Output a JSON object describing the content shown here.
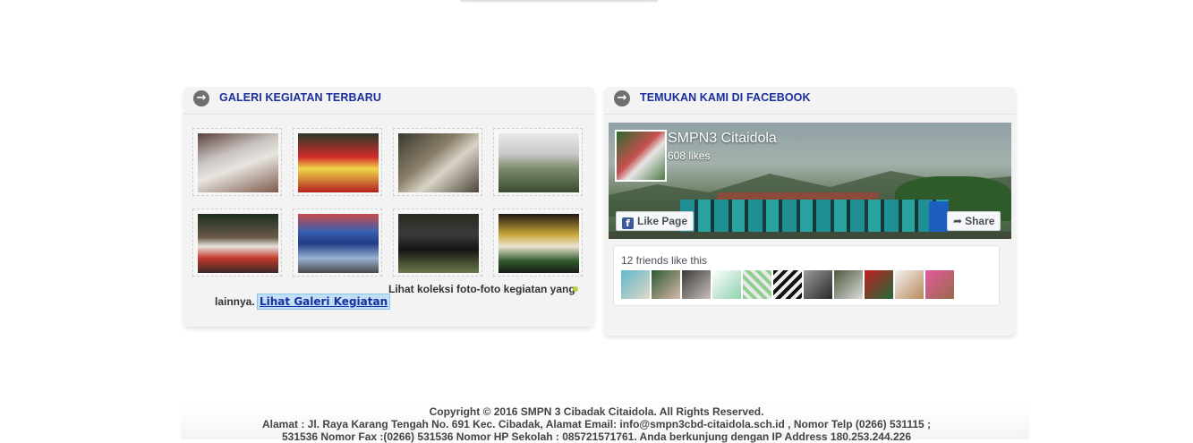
{
  "gallery": {
    "title": "GALERI KEGIATAN TERBARU",
    "photos": [
      "Foto kegiatan 1",
      "Foto kegiatan 2",
      "Foto kegiatan 3",
      "Foto kegiatan 4",
      "Foto kegiatan 5",
      "Foto kegiatan 6",
      "Foto kegiatan 7",
      "Foto kegiatan 8"
    ],
    "text_line1": "Lihat koleksi foto-foto kegiatan yang",
    "text_line2": "lainnya.",
    "link_label": "Lihat Galeri Kegiatan"
  },
  "facebook": {
    "title": "TEMUKAN KAMI DI FACEBOOK",
    "page_name": "SMPN3 Citaidola",
    "likes": "608 likes",
    "like_button": "Like Page",
    "share_button": "Share",
    "friends_text": "12 friends like this",
    "friend_count": 12
  },
  "footer": {
    "copyright": "Copyright © 2016 SMPN 3 Cibadak Citaidola. All Rights Reserved.",
    "address_line1": "Alamat : Jl. Raya Karang Tengah No. 691 Kec. Cibadak, Alamat Email: info@smpn3cbd-citaidola.sch.id , Nomor Telp (0266) 531115 ;",
    "address_line2": "531536 Nomor Fax :(0266) 531536 Nomor HP Sekolah : 085721571761. Anda berkunjung dengan IP Address 180.253.244.226"
  }
}
